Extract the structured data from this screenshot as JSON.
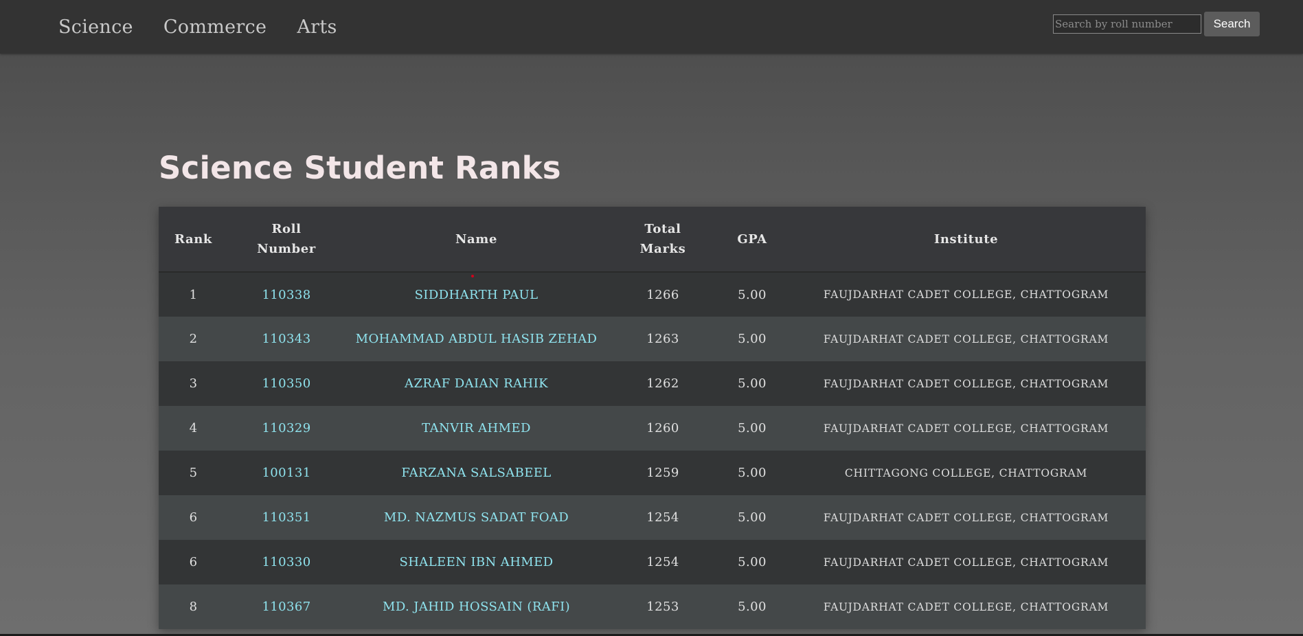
{
  "nav": {
    "links": [
      "Science",
      "Commerce",
      "Arts"
    ]
  },
  "search": {
    "placeholder": "Search by roll number",
    "button_label": "Search"
  },
  "page": {
    "title": "Science Student Ranks"
  },
  "table": {
    "headers": {
      "rank": "Rank",
      "roll_line1": "Roll",
      "roll_line2": "Number",
      "name": "Name",
      "total_line1": "Total",
      "total_line2": "Marks",
      "gpa": "GPA",
      "institute": "Institute"
    },
    "rows": [
      {
        "rank": "1",
        "roll": "110338",
        "name": "SIDDHARTH PAUL",
        "total": "1266",
        "gpa": "5.00",
        "institute": "FAUJDARHAT CADET COLLEGE, CHATTOGRAM"
      },
      {
        "rank": "2",
        "roll": "110343",
        "name": "MOHAMMAD ABDUL HASIB ZEHAD",
        "total": "1263",
        "gpa": "5.00",
        "institute": "FAUJDARHAT CADET COLLEGE, CHATTOGRAM"
      },
      {
        "rank": "3",
        "roll": "110350",
        "name": "AZRAF DAIAN RAHIK",
        "total": "1262",
        "gpa": "5.00",
        "institute": "FAUJDARHAT CADET COLLEGE, CHATTOGRAM"
      },
      {
        "rank": "4",
        "roll": "110329",
        "name": "TANVIR AHMED",
        "total": "1260",
        "gpa": "5.00",
        "institute": "FAUJDARHAT CADET COLLEGE, CHATTOGRAM"
      },
      {
        "rank": "5",
        "roll": "100131",
        "name": "FARZANA SALSABEEL",
        "total": "1259",
        "gpa": "5.00",
        "institute": "CHITTAGONG COLLEGE, CHATTOGRAM"
      },
      {
        "rank": "6",
        "roll": "110351",
        "name": "MD. NAZMUS SADAT FOAD",
        "total": "1254",
        "gpa": "5.00",
        "institute": "FAUJDARHAT CADET COLLEGE, CHATTOGRAM"
      },
      {
        "rank": "6",
        "roll": "110330",
        "name": "SHALEEN IBN AHMED",
        "total": "1254",
        "gpa": "5.00",
        "institute": "FAUJDARHAT CADET COLLEGE, CHATTOGRAM"
      },
      {
        "rank": "8",
        "roll": "110367",
        "name": "MD. JAHID HOSSAIN (RAFI)",
        "total": "1253",
        "gpa": "5.00",
        "institute": "FAUJDARHAT CADET COLLEGE, CHATTOGRAM"
      }
    ]
  },
  "colors": {
    "nav_bg": "#333333",
    "link_accent": "#8fe3ee",
    "title_color": "#f3e6e8"
  }
}
